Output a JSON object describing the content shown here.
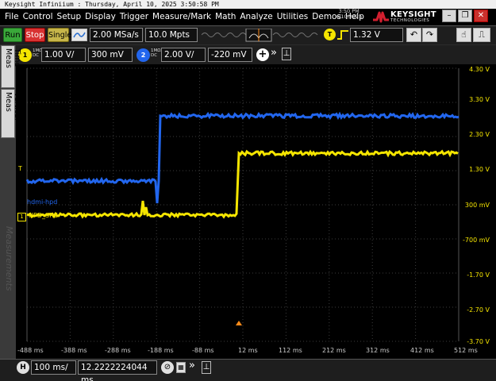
{
  "window": {
    "title": "Keysight Infiniium : Thursday, April 10, 2025 3:50:58 PM"
  },
  "menu": [
    "File",
    "Control",
    "Setup",
    "Display",
    "Trigger",
    "Measure/Mark",
    "Math",
    "Analyze",
    "Utilities",
    "Demos",
    "Help"
  ],
  "clock": {
    "time": "3:50 PM",
    "date": "4/10/2025"
  },
  "brand": {
    "name": "KEYSIGHT",
    "sub": "TECHNOLOGIES"
  },
  "controls": {
    "run": "Run",
    "stop": "Stop",
    "single": "Single"
  },
  "acquisition": {
    "sample_rate": "2.00 MSa/s",
    "memory_depth": "10.0 Mpts"
  },
  "trigger": {
    "badge": "T",
    "level": "1.32 V"
  },
  "channels": [
    {
      "number": "1",
      "coupling": "1MΩ",
      "mode": "DC",
      "scale": "1.00 V/",
      "offset": "300 mV",
      "color": "#f5e500"
    },
    {
      "number": "2",
      "coupling": "1MΩ",
      "mode": "DC",
      "scale": "2.00 V/",
      "offset": "-220 mV",
      "color": "#2266ee"
    }
  ],
  "side_tabs": {
    "time_meas": "Time Meas",
    "vertical_meas": "Vertical Meas",
    "measurements": "Measurements"
  },
  "waveform": {
    "y_labels": [
      "4.30 V",
      "3.30 V",
      "2.30 V",
      "1.30 V",
      "300 mV",
      "-700 mV",
      "-1.70 V",
      "-2.70 V",
      "-3.70 V"
    ],
    "x_labels": [
      "-488 ms",
      "-388 ms",
      "-288 ms",
      "-188 ms",
      "-88 ms",
      "12 ms",
      "112 ms",
      "212 ms",
      "312 ms",
      "412 ms",
      "512 ms"
    ],
    "trace_labels": {
      "ch2": "hdmi-hpd",
      "ch1": "HPD_SRC"
    },
    "markers": {
      "trigger": "T",
      "ch1": "1"
    },
    "colors": {
      "ch1": "#f5e500",
      "ch2": "#2266ee",
      "grid": "#3c3c3c",
      "trigger_marker": "#ff8c1a"
    }
  },
  "timebase": {
    "badge": "H",
    "scale": "100 ms/",
    "position": "12.2222224044 ms"
  }
}
